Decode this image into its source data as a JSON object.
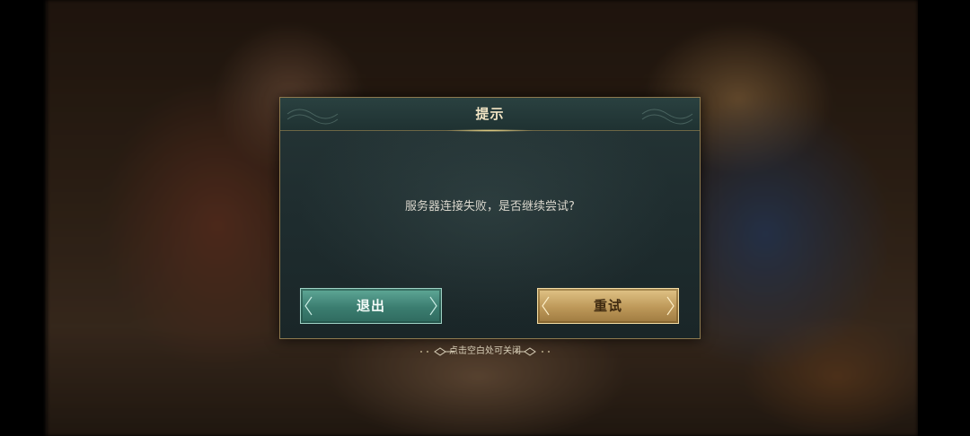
{
  "dialog": {
    "title": "提示",
    "message": "服务器连接失败，是否继续尝试?",
    "buttons": {
      "exit_label": "退出",
      "retry_label": "重试"
    }
  },
  "hint": {
    "text": "点击空白处可关闭"
  },
  "colors": {
    "exit_button": "#3b7d70",
    "retry_button": "#bd9859",
    "dialog_border": "#8e7a4f",
    "title_text": "#f1e4c4"
  }
}
